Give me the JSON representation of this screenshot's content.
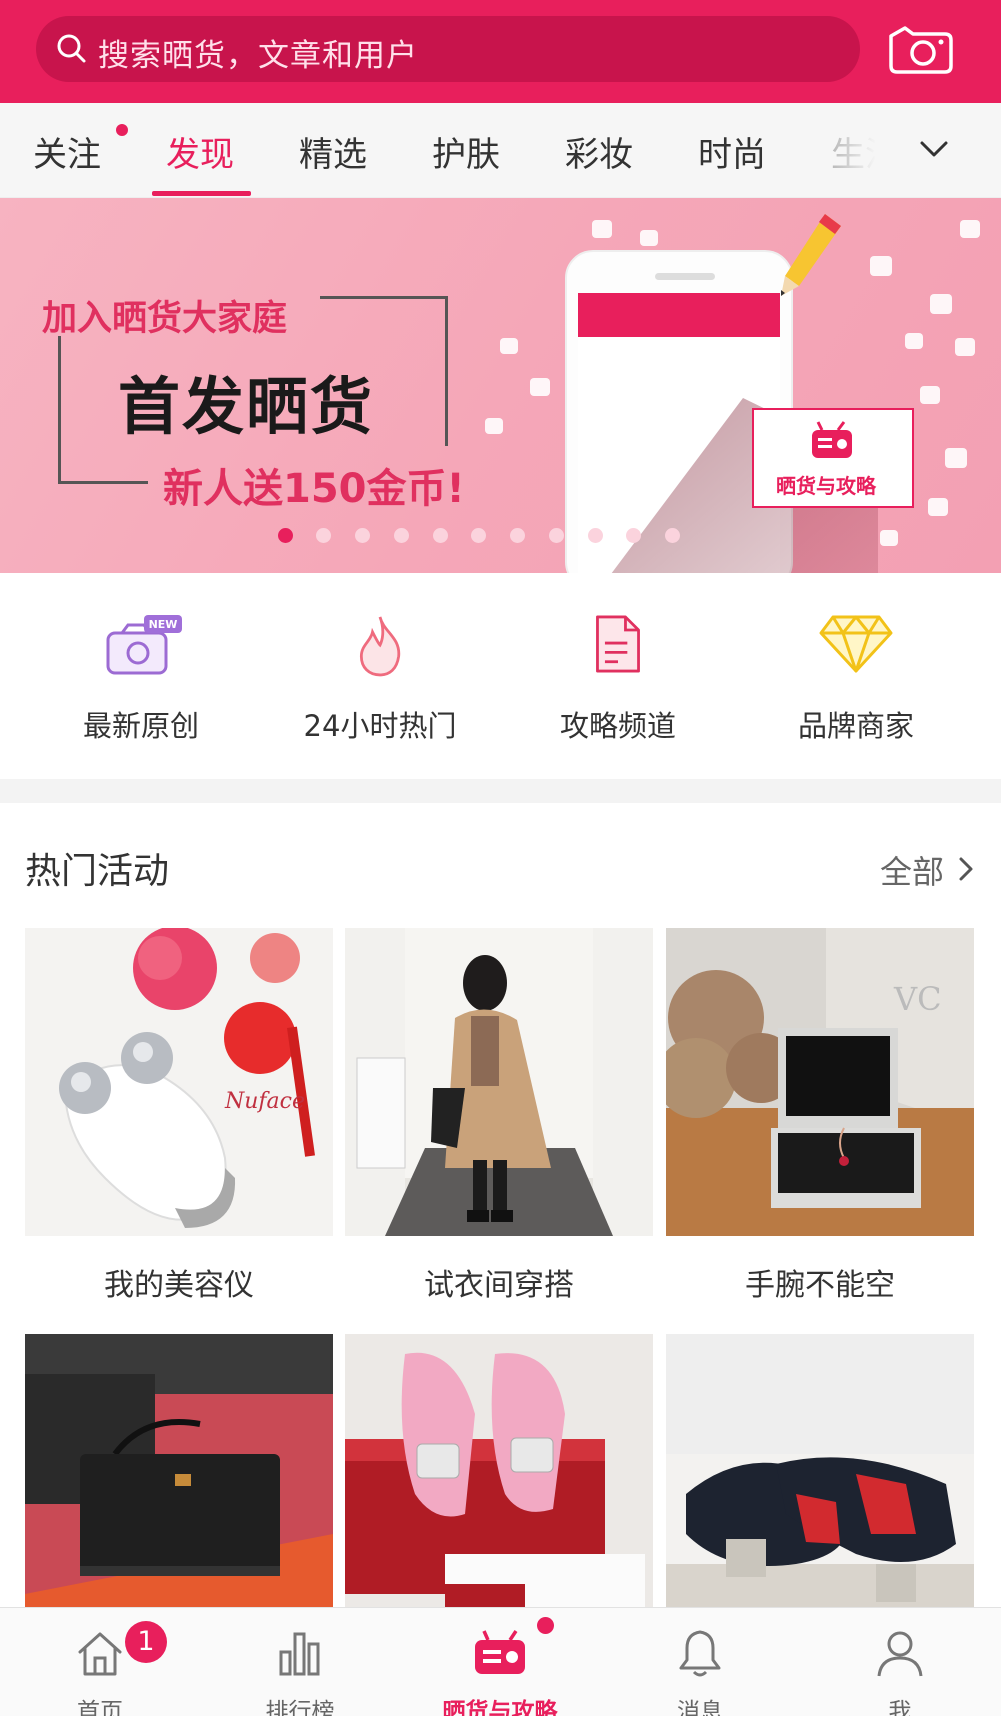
{
  "search": {
    "placeholder": "搜索晒货，文章和用户"
  },
  "tabs": [
    {
      "label": "关注"
    },
    {
      "label": "发现"
    },
    {
      "label": "精选"
    },
    {
      "label": "护肤"
    },
    {
      "label": "彩妆"
    },
    {
      "label": "时尚"
    },
    {
      "label": "生活"
    }
  ],
  "banner": {
    "line1": "加入晒货大家庭",
    "line2": "首发晒货",
    "line3": "新人送150金币!",
    "badge": "晒货与攻略",
    "active_slide": 1,
    "slide_count": 12
  },
  "shortcuts": [
    {
      "label": "最新原创",
      "icon": "new-camera-icon",
      "badge": "NEW"
    },
    {
      "label": "24小时热门",
      "icon": "flame-icon"
    },
    {
      "label": "攻略频道",
      "icon": "document-icon"
    },
    {
      "label": "品牌商家",
      "icon": "diamond-icon"
    }
  ],
  "hot_activities": {
    "title": "热门活动",
    "more": "全部",
    "items": [
      {
        "label": "我的美容仪"
      },
      {
        "label": "试衣间穿搭"
      },
      {
        "label": "手腕不能空"
      },
      {
        "label": ""
      },
      {
        "label": ""
      },
      {
        "label": ""
      }
    ]
  },
  "bottom_nav": [
    {
      "label": "首页",
      "icon": "home-icon",
      "badge": "1"
    },
    {
      "label": "排行榜",
      "icon": "bar-chart-icon"
    },
    {
      "label": "晒货与攻略",
      "icon": "shaihuo-icon"
    },
    {
      "label": "消息",
      "icon": "bell-icon"
    },
    {
      "label": "我",
      "icon": "user-icon"
    }
  ],
  "colors": {
    "accent": "#e81f5c",
    "header": "#e81f5c",
    "search_bg": "#c8144c"
  }
}
